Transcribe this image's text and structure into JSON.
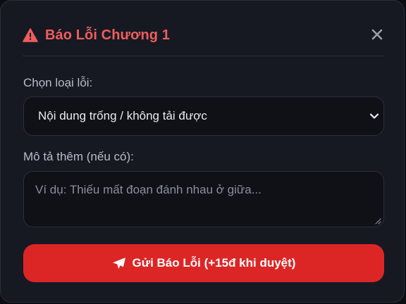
{
  "modal": {
    "title": "Báo Lỗi Chương 1",
    "error_type": {
      "label": "Chọn loại lỗi:",
      "selected": "Nội dung trống / không tải được"
    },
    "description": {
      "label": "Mô tả thêm (nếu có):",
      "placeholder": "Ví dụ: Thiếu mất đoạn đánh nhau ở giữa...",
      "value": ""
    },
    "submit_label": "Gửi Báo Lỗi (+15đ khi duyệt)"
  },
  "icons": {
    "warning": "warning-triangle-icon",
    "close": "close-icon",
    "chevron": "chevron-down-icon",
    "send": "paper-plane-icon"
  },
  "colors": {
    "accent_red": "#dc2626",
    "title_red": "#ef5d5d",
    "background": "#161922"
  }
}
